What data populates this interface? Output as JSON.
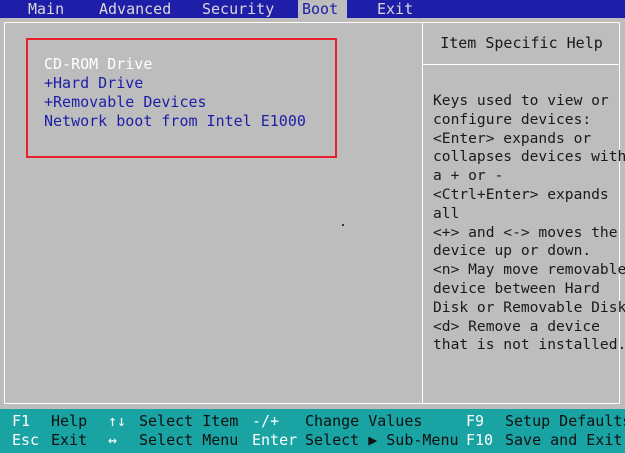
{
  "menu": {
    "tabs": [
      "Main",
      "Advanced",
      "Security",
      "Boot",
      "Exit"
    ],
    "active": "Boot"
  },
  "boot_list": {
    "items": [
      "CD-ROM Drive",
      "+Hard Drive",
      "+Removable Devices",
      "Network boot from Intel E1000"
    ]
  },
  "help": {
    "title": "Item Specific Help",
    "lines": [
      "Keys used to view or",
      "configure devices:",
      "<Enter> expands or",
      "collapses devices with",
      "a + or -",
      "<Ctrl+Enter> expands",
      "all",
      "<+> and <-> moves the",
      "device up or down.",
      "<n> May move removable",
      "device between Hard",
      "Disk or Removable Disk",
      "<d> Remove a device",
      "that is not installed."
    ]
  },
  "footer": {
    "row1": [
      {
        "key": "F1",
        "desc": "Help"
      },
      {
        "key": "↑↓",
        "desc": "Select Item"
      },
      {
        "key": "-/+",
        "desc": "Change Values"
      },
      {
        "key": "F9",
        "desc": "Setup Defaults"
      }
    ],
    "row2": [
      {
        "key": "Esc",
        "desc": "Exit"
      },
      {
        "key": "↔",
        "desc": "Select Menu"
      },
      {
        "key": "Enter",
        "desc": "Select ▶ Sub-Menu"
      },
      {
        "key": "F10",
        "desc": "Save and Exit"
      }
    ]
  },
  "colors": {
    "menu_bg": "#1e1ea8",
    "panel_bg": "#bdbdbd",
    "footer_bg": "#1aa3a3",
    "highlight_border": "#e8202a"
  }
}
